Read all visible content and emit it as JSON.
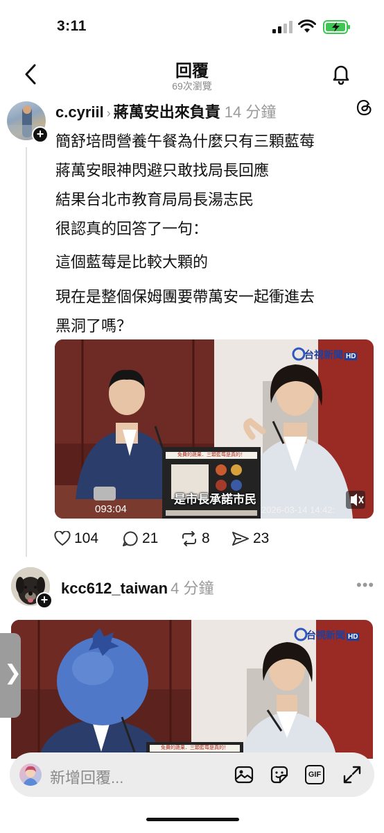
{
  "status_bar": {
    "time": "3:11"
  },
  "header": {
    "title": "回覆",
    "views": "69次瀏覽"
  },
  "post1": {
    "username": "c.cyriil",
    "topic": "蔣萬安出來負責",
    "time": "14 分鐘",
    "lines": [
      "簡舒培問營養午餐為什麼只有三顆藍莓",
      "蔣萬安眼神閃避只敢找局長回應",
      "結果台北市教育局局長湯志民",
      "很認真的回答了一句：",
      "這個藍莓是比較大顆的",
      "現在是整個保姆團要帶萬安一起衝進去",
      "黑洞了嗎？"
    ],
    "media": {
      "watermark": "台視新聞",
      "watermark_hd": "HD",
      "caption": "是市長承諾市民",
      "timer": "093:04",
      "timestamp": "2026-03-14 14:42:",
      "slide_title": "免費的蔬果．三顆藍莓是真的！"
    },
    "counts": {
      "likes": "104",
      "comments": "21",
      "reposts": "8",
      "shares": "23"
    }
  },
  "post2": {
    "username": "kcc612_taiwan",
    "time": "4 分鐘",
    "media": {
      "watermark": "台視新聞",
      "watermark_hd": "HD",
      "slide_title": "免費的蔬果．三顆藍莓是真的！"
    }
  },
  "reply_bar": {
    "placeholder": "新增回覆...",
    "gif_label": "GIF"
  },
  "side_tab": {
    "glyph": "❯"
  },
  "icons": [
    "chevron-left-icon",
    "bell-icon",
    "threads-icon",
    "heart-icon",
    "comment-icon",
    "repost-icon",
    "share-icon",
    "more-icon",
    "image-icon",
    "sticker-icon",
    "gif-icon",
    "expand-icon"
  ]
}
